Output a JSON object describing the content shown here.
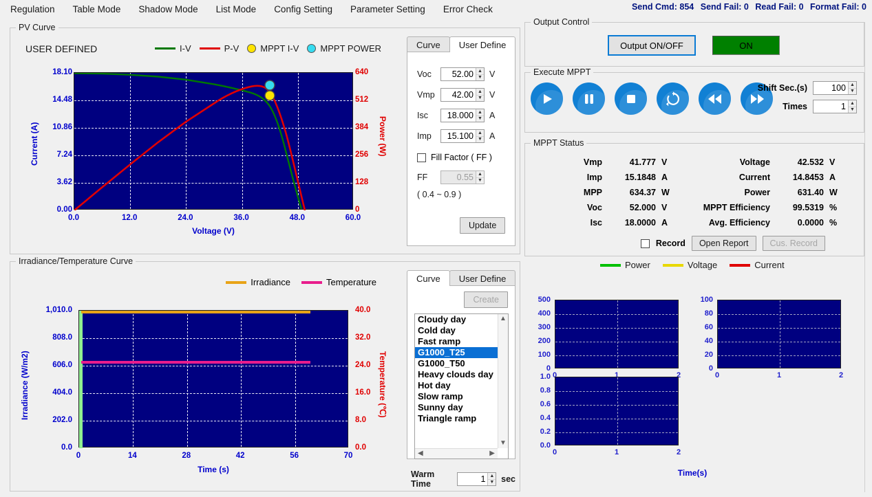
{
  "menu": {
    "items": [
      "Regulation",
      "Table Mode",
      "Shadow Mode",
      "List Mode",
      "Config Setting",
      "Parameter Setting",
      "Error Check"
    ],
    "status": {
      "send_cmd": "Send Cmd: 854",
      "send_fail": "Send Fail: 0",
      "read_fail": "Read Fail: 0",
      "format_fail": "Format Fail: 0"
    }
  },
  "pv_panel": {
    "title": "PV Curve",
    "mode_label": "USER DEFINED",
    "legend": [
      {
        "label": "I-V",
        "type": "line",
        "color": "#007800"
      },
      {
        "label": "P-V",
        "type": "line",
        "color": "#e00000"
      },
      {
        "label": "MPPT I-V",
        "type": "dot",
        "color": "#ffe400"
      },
      {
        "label": "MPPT POWER",
        "type": "dot",
        "color": "#36dcf0"
      }
    ],
    "tabs": [
      {
        "label": "Curve",
        "active": false
      },
      {
        "label": "User Define",
        "active": true
      }
    ],
    "fields": [
      {
        "label": "Voc",
        "value": "52.00",
        "unit": "V"
      },
      {
        "label": "Vmp",
        "value": "42.00",
        "unit": "V"
      },
      {
        "label": "Isc",
        "value": "18.000",
        "unit": "A"
      },
      {
        "label": "Imp",
        "value": "15.100",
        "unit": "A"
      }
    ],
    "fill_factor_label": "Fill Factor ( FF )",
    "ff_label": "FF",
    "ff_value": "0.55",
    "ff_range_hint": "( 0.4 ~ 0.9 )",
    "update_label": "Update"
  },
  "output_control": {
    "title": "Output Control",
    "button_label": "Output ON/OFF",
    "state_label": "ON",
    "state_color": "#008000"
  },
  "execute_mppt": {
    "title": "Execute MPPT",
    "buttons": [
      {
        "name": "play",
        "icon": "play-icon"
      },
      {
        "name": "pause",
        "icon": "pause-icon"
      },
      {
        "name": "stop",
        "icon": "stop-icon"
      },
      {
        "name": "loop",
        "icon": "refresh-icon"
      },
      {
        "name": "rewind",
        "icon": "rewind-icon"
      },
      {
        "name": "forward",
        "icon": "forward-icon"
      }
    ],
    "shift_label": "Shift Sec.(s)",
    "shift_value": "100",
    "times_label": "Times",
    "times_value": "1"
  },
  "mppt_status": {
    "title": "MPPT Status",
    "rows": [
      {
        "k1": "Vmp",
        "v1": "41.777",
        "u1": "V",
        "k2": "Voltage",
        "v2": "42.532",
        "u2": "V"
      },
      {
        "k1": "Imp",
        "v1": "15.1848",
        "u1": "A",
        "k2": "Current",
        "v2": "14.8453",
        "u2": "A"
      },
      {
        "k1": "MPP",
        "v1": "634.37",
        "u1": "W",
        "k2": "Power",
        "v2": "631.40",
        "u2": "W"
      },
      {
        "k1": "Voc",
        "v1": "52.000",
        "u1": "V",
        "k2": "MPPT Efficiency",
        "v2": "99.5319",
        "u2": "%"
      },
      {
        "k1": "Isc",
        "v1": "18.0000",
        "u1": "A",
        "k2": "Avg. Efficiency",
        "v2": "0.0000",
        "u2": "%"
      }
    ],
    "record_label": "Record",
    "open_report_label": "Open Report",
    "cus_record_label": "Cus. Record"
  },
  "irradiance_panel": {
    "title": "Irradiance/Temperature Curve",
    "legend": [
      {
        "label": "Irradiance",
        "color": "#e8a317"
      },
      {
        "label": "Temperature",
        "color": "#e81d8c"
      }
    ],
    "tabs": [
      {
        "label": "Curve",
        "active": true
      },
      {
        "label": "User Define",
        "active": false
      }
    ],
    "create_label": "Create",
    "curve_list": [
      "Cloudy day",
      "Cold day",
      "Fast ramp",
      "G1000_T25",
      "G1000_T50",
      "Heavy clouds day",
      "Hot day",
      "Slow ramp",
      "Sunny day",
      "Triangle ramp"
    ],
    "selected_curve": "G1000_T25",
    "warm_time_label": "Warm Time",
    "warm_time_value": "1",
    "warm_time_unit": "sec"
  },
  "mini_charts": {
    "legend": [
      {
        "label": "Power",
        "color": "#00c000"
      },
      {
        "label": "Voltage",
        "color": "#e8d800"
      },
      {
        "label": "Current",
        "color": "#e00000"
      }
    ],
    "time_axis_label": "Time(s)"
  },
  "chart_data": [
    {
      "type": "line",
      "name": "pv-curve",
      "title": "PV Curve",
      "xlabel": "Voltage (V)",
      "ylabel": "Current (A)",
      "y2label": "Power (W)",
      "xlim": [
        0,
        60
      ],
      "ylim": [
        0,
        18.1
      ],
      "y2lim": [
        0,
        640
      ],
      "xticks": [
        "0.0",
        "12.0",
        "24.0",
        "36.0",
        "48.0",
        "60.0"
      ],
      "yticks": [
        "0.00",
        "3.62",
        "7.24",
        "10.86",
        "14.48",
        "18.10"
      ],
      "y2ticks": [
        "0",
        "128",
        "256",
        "384",
        "512",
        "640"
      ],
      "grid": true,
      "background": "#000080",
      "series": [
        {
          "name": "I-V",
          "color": "#007800",
          "x": [
            0,
            6,
            12,
            18,
            24,
            30,
            34,
            38,
            41,
            42,
            43.5,
            45,
            46.5,
            48,
            49.5,
            51,
            52
          ],
          "y": [
            18.05,
            18.0,
            17.85,
            17.6,
            17.2,
            16.6,
            16.1,
            15.6,
            15.2,
            15.1,
            14.5,
            13.2,
            10.8,
            7.6,
            4.3,
            1.2,
            0.0
          ]
        },
        {
          "name": "P-V",
          "color": "#e00000",
          "x": [
            0,
            6,
            12,
            18,
            24,
            30,
            34,
            38,
            41,
            42,
            43.5,
            45,
            46.5,
            48,
            49.5,
            51,
            52
          ],
          "y": [
            0,
            108,
            214,
            317,
            413,
            498,
            547,
            593,
            623,
            634,
            631,
            594,
            502,
            365,
            213,
            61,
            0
          ]
        }
      ],
      "markers": [
        {
          "name": "MPPT POWER",
          "x": 42,
          "y": 634.37,
          "axis": "y2",
          "color": "#36dcf0"
        },
        {
          "name": "MPPT I-V",
          "x": 42,
          "y": 15.1848,
          "axis": "y",
          "color": "#ffe400"
        }
      ]
    },
    {
      "type": "line",
      "name": "irradiance-temperature-curve",
      "title": "Irradiance/Temperature Curve",
      "xlabel": "Time (s)",
      "ylabel": "Irradiance (W/m2)",
      "y2label": "Temperature (℃)",
      "xlim": [
        0,
        70
      ],
      "ylim": [
        0,
        1010
      ],
      "y2lim": [
        0,
        40
      ],
      "xticks": [
        "0",
        "14",
        "28",
        "42",
        "56",
        "70"
      ],
      "yticks": [
        "0.0",
        "202.0",
        "404.0",
        "606.0",
        "808.0",
        "1,010.0"
      ],
      "y2ticks": [
        "0.0",
        "8.0",
        "16.0",
        "24.0",
        "32.0",
        "40.0"
      ],
      "grid": true,
      "background": "#000080",
      "series": [
        {
          "name": "Irradiance",
          "color": "#e8a317",
          "x": [
            0,
            60
          ],
          "y": [
            1000,
            1000
          ]
        },
        {
          "name": "Temperature",
          "color": "#e81d8c",
          "x": [
            0,
            60
          ],
          "y": [
            25,
            25
          ],
          "axis": "y2"
        }
      ]
    },
    {
      "type": "line",
      "name": "power-mini-chart",
      "xlim": [
        0,
        2
      ],
      "ylim": [
        0,
        500
      ],
      "xticks": [
        "0",
        "1",
        "2"
      ],
      "yticks": [
        "0",
        "100",
        "200",
        "300",
        "400",
        "500"
      ],
      "grid": true,
      "background": "#000080",
      "series": []
    },
    {
      "type": "line",
      "name": "voltage-mini-chart",
      "xlim": [
        0,
        2
      ],
      "ylim": [
        0,
        100
      ],
      "xticks": [
        "0",
        "1",
        "2"
      ],
      "yticks": [
        "0",
        "20",
        "40",
        "60",
        "80",
        "100"
      ],
      "grid": true,
      "background": "#000080",
      "series": []
    },
    {
      "type": "line",
      "name": "current-mini-chart",
      "xlabel": "Time(s)",
      "xlim": [
        0,
        2
      ],
      "ylim": [
        0,
        1.0
      ],
      "xticks": [
        "0",
        "1",
        "2"
      ],
      "yticks": [
        "0.0",
        "0.2",
        "0.4",
        "0.6",
        "0.8",
        "1.0"
      ],
      "grid": true,
      "background": "#000080",
      "series": []
    }
  ]
}
